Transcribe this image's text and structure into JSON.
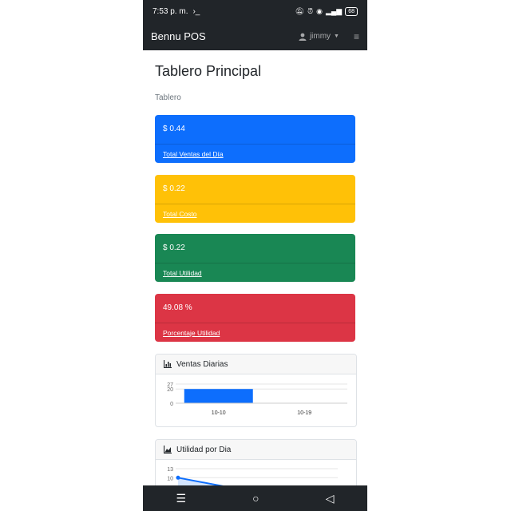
{
  "status": {
    "time": "7:53 p. m.",
    "battery": "68"
  },
  "navbar": {
    "brand": "Bennu POS",
    "user": "jimmy"
  },
  "page": {
    "title": "Tablero Principal",
    "breadcrumb": "Tablero"
  },
  "cards": [
    {
      "value": "$ 0.44",
      "link": "Total Ventas del Día",
      "color": "#0d6efd"
    },
    {
      "value": "$ 0.22",
      "link": "Total Costo",
      "color": "#ffc107"
    },
    {
      "value": "$ 0.22",
      "link": "Total Utilidad",
      "color": "#198754"
    },
    {
      "value": "49.08 %",
      "link": "Porcentaje Utilidad",
      "color": "#dc3545"
    }
  ],
  "panels": {
    "ventas": {
      "title": "Ventas Diarias"
    },
    "utilidad": {
      "title": "Utilidad por Dia"
    }
  },
  "chart_data": [
    {
      "type": "bar",
      "title": "Ventas Diarias",
      "categories": [
        "10-10",
        "10-19"
      ],
      "values": [
        20,
        0.4
      ],
      "ylim": [
        0,
        27
      ],
      "ytick_labels": [
        "27",
        "20",
        "0"
      ],
      "color": "#0d6efd"
    },
    {
      "type": "area",
      "title": "Utilidad por Dia",
      "values": [
        10,
        0
      ],
      "ylim": [
        0,
        13
      ],
      "ytick_labels": [
        "13",
        "10"
      ],
      "color": "#0d6efd"
    }
  ]
}
